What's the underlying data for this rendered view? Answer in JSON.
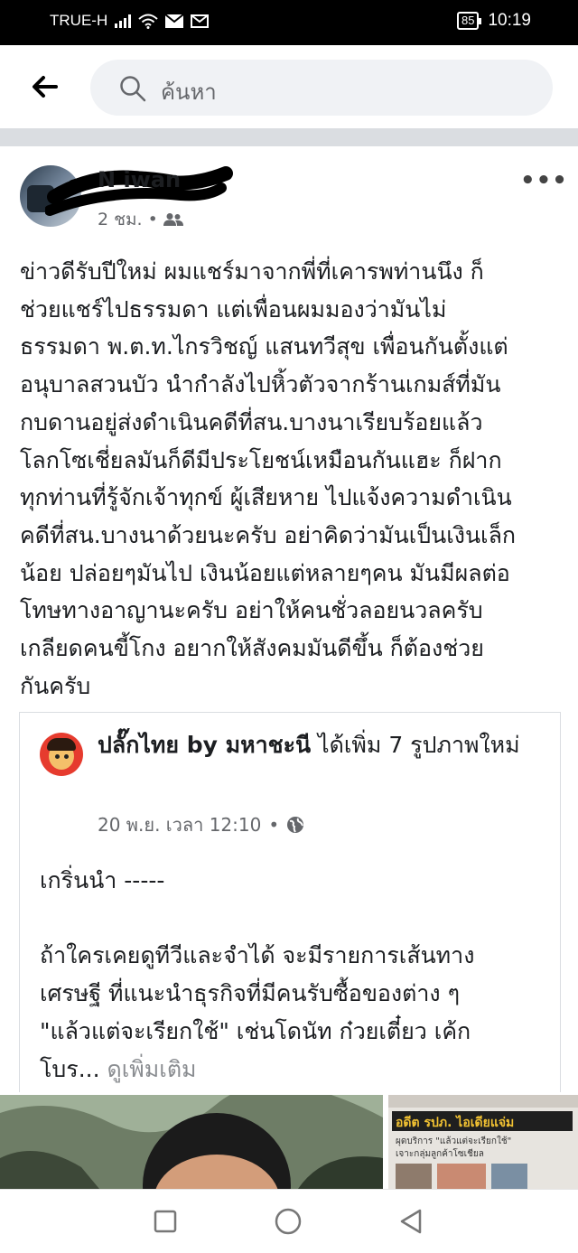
{
  "status_bar": {
    "carrier": "TRUE-H",
    "battery": "85",
    "time": "10:19"
  },
  "header": {
    "search_placeholder": "ค้นหา"
  },
  "post": {
    "author_visible": "N        iwan",
    "time": "2 ชม.",
    "audience_icon": "friends-icon",
    "more_icon": "more-options-icon",
    "text": "ข่าวดีรับปีใหม่ ผมแชร์มาจากพี่ที่เคารพท่านนึง ก็\nช่วยแชร์ไปธรรมดา แต่เพื่อนผมมองว่ามันไม่\nธรรมดา พ.ต.ท.ไกรวิชญ์ แสนทวีสุข เพื่อนกันตั้งแต่\nอนุบาลสวนบัว นำกำลังไปหิ้วตัวจากร้านเกมส์ที่มัน\nกบดานอยู่ส่งดำเนินคดีที่สน.บางนาเรียบร้อยแล้ว\nโลกโซเชี่ยลมันก็ดีมีประโยชน์เหมือนกันแฮะ ก็ฝาก\nทุกท่านที่รู้จักเจ้าทุกข์ ผู้เสียหาย ไปแจ้งความดำเนิน\nคดีที่สน.บางนาด้วยนะครับ อย่าคิดว่ามันเป็นเงินเล็ก\nน้อย ปล่อยๆมันไป เงินน้อยแต่หลายๆคน มันมีผลต่อ\nโทษทางอาญานะครับ อย่าให้คนชั่วลอยนวลครับ\nเกลียดคนขี้โกง อยากให้สังคมมันดีขึ้น ก็ต้องช่วย\nกันครับ"
  },
  "shared": {
    "page_name": "ปลั๊กไทย by มหาชะนี",
    "action": " ได้เพิ่ม 7 รูปภาพใหม่",
    "date": "20 พ.ย. เวลา 12:10",
    "privacy_icon": "globe-icon",
    "text": "เกริ่นนำ -----\n\nถ้าใครเคยดูทีวีและจำได้ จะมีรายการเส้นทาง\nเศรษฐี ที่แนะนำธุรกิจที่มีคนรับซื้อของต่าง ๆ\n\"แล้วแต่จะเรียกใช้\" เช่นโดนัท ก๋วยเตี๋ยว เค้ก\nโบร...",
    "see_more": "ดูเพิ่มเติม"
  },
  "photos": {
    "headline": "อดีต รปภ. ไอเดียแจ่ม",
    "subline1": "ผุดบริการ \"แล้วแต่จะเรียกใช้\"",
    "subline2": "เจาะกลุ่มลูกค้าโซเชียล"
  },
  "nav": {
    "recents_icon": "square-recents-icon",
    "home_icon": "circle-home-icon",
    "back_icon": "triangle-back-icon"
  }
}
